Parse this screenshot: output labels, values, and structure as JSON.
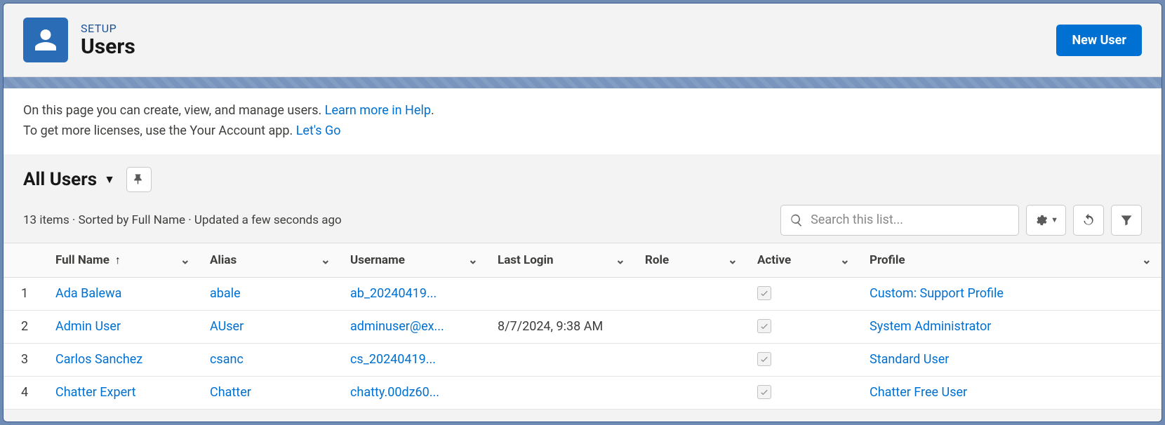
{
  "header": {
    "setup_label": "SETUP",
    "title": "Users",
    "new_user_label": "New User"
  },
  "info": {
    "line1_prefix": "On this page you can create, view, and manage users. ",
    "line1_link": "Learn more in Help",
    "line1_suffix": ".",
    "line2_prefix": "To get more licenses, use the Your Account app. ",
    "line2_link": "Let's Go"
  },
  "list": {
    "view_name": "All Users",
    "status": "13 items · Sorted by Full Name · Updated a few seconds ago",
    "search_placeholder": "Search this list..."
  },
  "columns": {
    "full_name": "Full Name",
    "alias": "Alias",
    "username": "Username",
    "last_login": "Last Login",
    "role": "Role",
    "active": "Active",
    "profile": "Profile"
  },
  "rows": [
    {
      "num": "1",
      "full_name": "Ada Balewa",
      "alias": "abale",
      "username": "ab_20240419...",
      "last_login": "",
      "role": "",
      "active": true,
      "profile": "Custom: Support Profile"
    },
    {
      "num": "2",
      "full_name": "Admin User",
      "alias": "AUser",
      "username": "adminuser@ex...",
      "last_login": "8/7/2024, 9:38 AM",
      "role": "",
      "active": true,
      "profile": "System Administrator"
    },
    {
      "num": "3",
      "full_name": "Carlos Sanchez",
      "alias": "csanc",
      "username": "cs_20240419...",
      "last_login": "",
      "role": "",
      "active": true,
      "profile": "Standard User"
    },
    {
      "num": "4",
      "full_name": "Chatter Expert",
      "alias": "Chatter",
      "username": "chatty.00dz60...",
      "last_login": "",
      "role": "",
      "active": true,
      "profile": "Chatter Free User"
    }
  ]
}
